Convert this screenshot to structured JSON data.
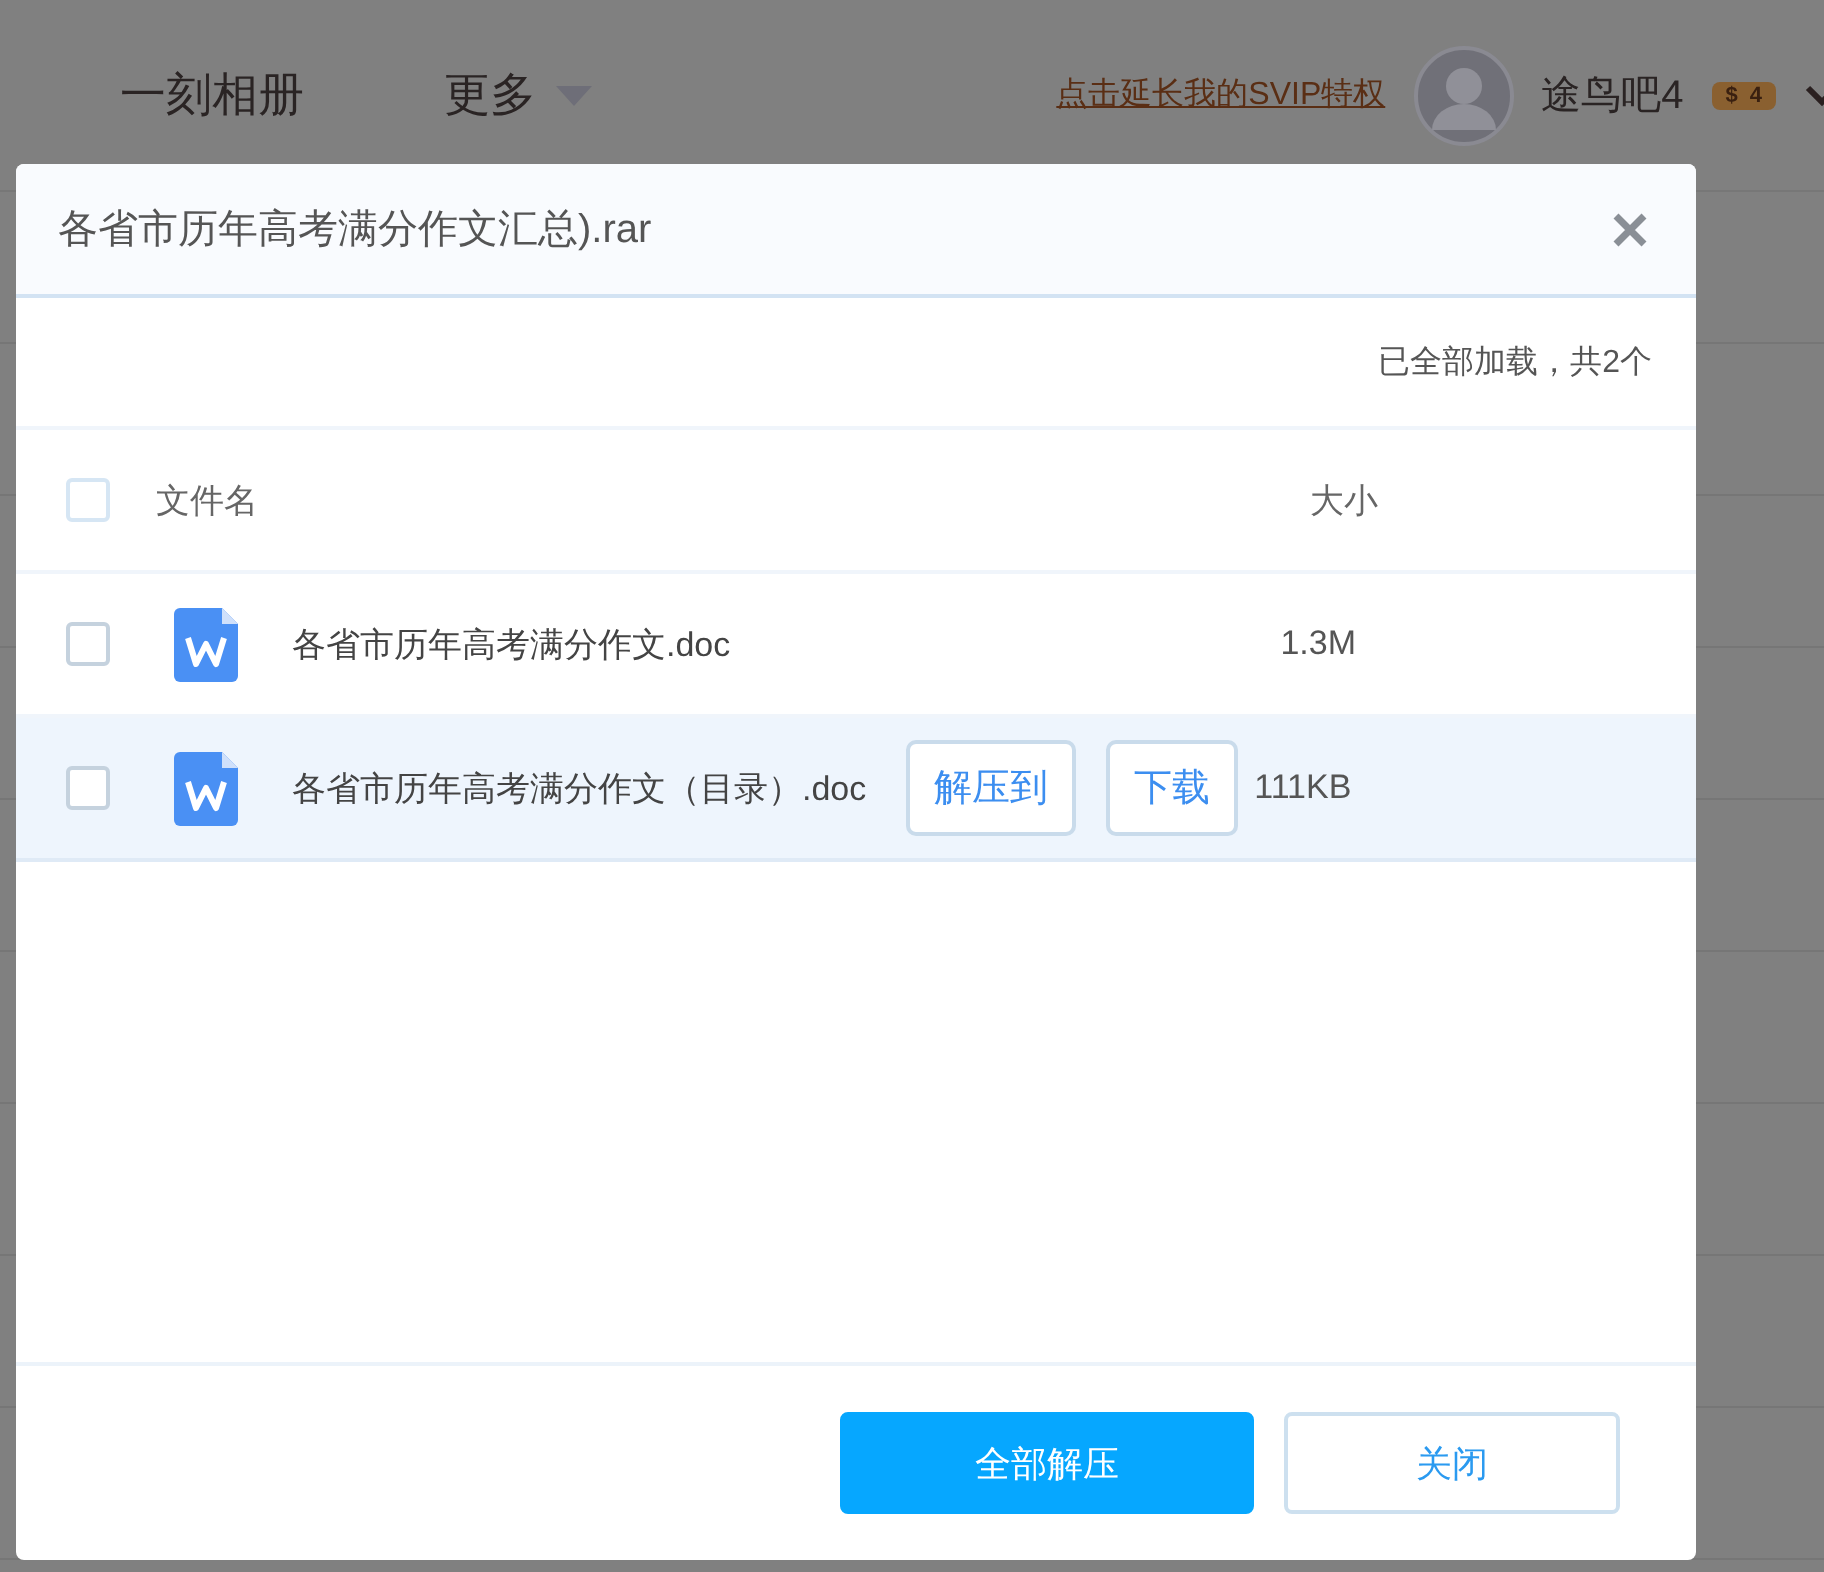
{
  "top_bar": {
    "nav": [
      {
        "label": "一刻相册",
        "has_caret": false
      },
      {
        "label": "更多",
        "has_caret": true
      }
    ],
    "svip_link": "点击延长我的SVIP特权",
    "user_name": "途鸟吧4",
    "badge": {
      "symbol": "$",
      "count": "4"
    }
  },
  "dialog": {
    "title": "各省市历年高考满分作文汇总).rar",
    "load_status": "已全部加载，共2个",
    "columns": {
      "name": "文件名",
      "size": "大小"
    },
    "all_checked": false,
    "files": [
      {
        "name": "各省市历年高考满分作文.doc",
        "size": "1.3M",
        "checked": false,
        "hovered": false
      },
      {
        "name": "各省市历年高考满分作文（目录）.doc",
        "size": "111KB",
        "checked": false,
        "hovered": true,
        "actions": [
          "解压到",
          "下载"
        ]
      }
    ],
    "buttons": [
      {
        "label": "全部解压",
        "kind": "primary"
      },
      {
        "label": "关闭",
        "kind": "secondary"
      }
    ]
  }
}
